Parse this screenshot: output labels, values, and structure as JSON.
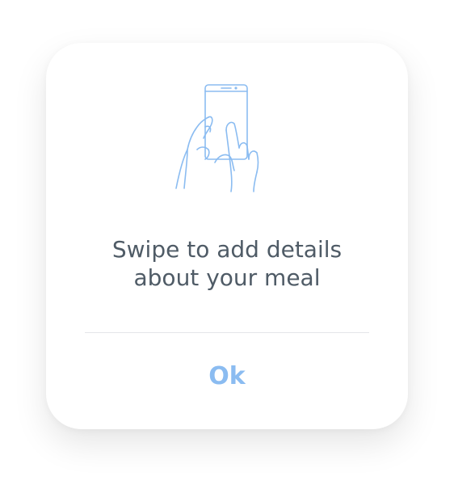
{
  "dialog": {
    "icon": "swipe-hand-phone-icon",
    "message_line1": "Swipe to add details",
    "message_line2": "about your meal",
    "ok_label": "Ok"
  },
  "colors": {
    "text": "#4f5b66",
    "accent": "#8bbcf1",
    "divider": "#e4e6e9",
    "background": "#ffffff"
  }
}
